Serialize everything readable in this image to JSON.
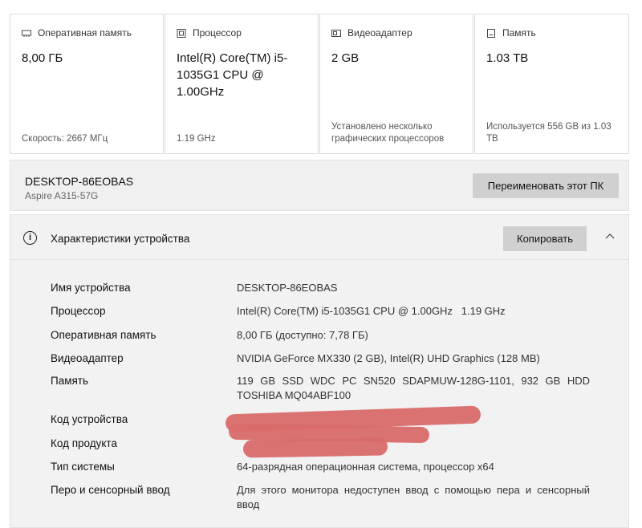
{
  "cards": [
    {
      "icon": "ram-icon",
      "title": "Оперативная память",
      "value": "8,00 ГБ",
      "sub": "Скорость: 2667 МГц"
    },
    {
      "icon": "cpu-icon",
      "title": "Процессор",
      "value": "Intel(R) Core(TM) i5-1035G1 CPU @ 1.00GHz",
      "sub": "1.19 GHz"
    },
    {
      "icon": "gpu-icon",
      "title": "Видеоадаптер",
      "value": "2 GB",
      "sub": "Установлено несколько графических процессоров"
    },
    {
      "icon": "storage-icon",
      "title": "Память",
      "value": "1.03 TB",
      "sub": "Используется 556 GB из 1.03 TB"
    }
  ],
  "pc": {
    "name": "DESKTOP-86EOBAS",
    "model": "Aspire A315-57G",
    "rename_label": "Переименовать этот ПК"
  },
  "specs": {
    "title": "Характеристики устройства",
    "copy_label": "Копировать",
    "rows": [
      {
        "k": "Имя устройства",
        "v": "DESKTOP-86EOBAS"
      },
      {
        "k": "Процессор",
        "v": "Intel(R) Core(TM) i5-1035G1 CPU @ 1.00GHz   1.19 GHz"
      },
      {
        "k": "Оперативная память",
        "v": "8,00 ГБ (доступно: 7,78 ГБ)"
      },
      {
        "k": "Видеоадаптер",
        "v": "NVIDIA GeForce MX330 (2 GB), Intel(R) UHD Graphics (128 MB)"
      },
      {
        "k": "Память",
        "v": "119 GB SSD WDC PC SN520 SDAPMUW-128G-1101, 932 GB HDD TOSHIBA MQ04ABF100"
      },
      {
        "k": "Код устройства",
        "v": ""
      },
      {
        "k": "Код продукта",
        "v": ""
      },
      {
        "k": "Тип системы",
        "v": "64-разрядная операционная система, процессор x64"
      },
      {
        "k": "Перо и сенсорный ввод",
        "v": "Для этого монитора недоступен ввод с помощью пера и сенсорный ввод"
      }
    ]
  }
}
